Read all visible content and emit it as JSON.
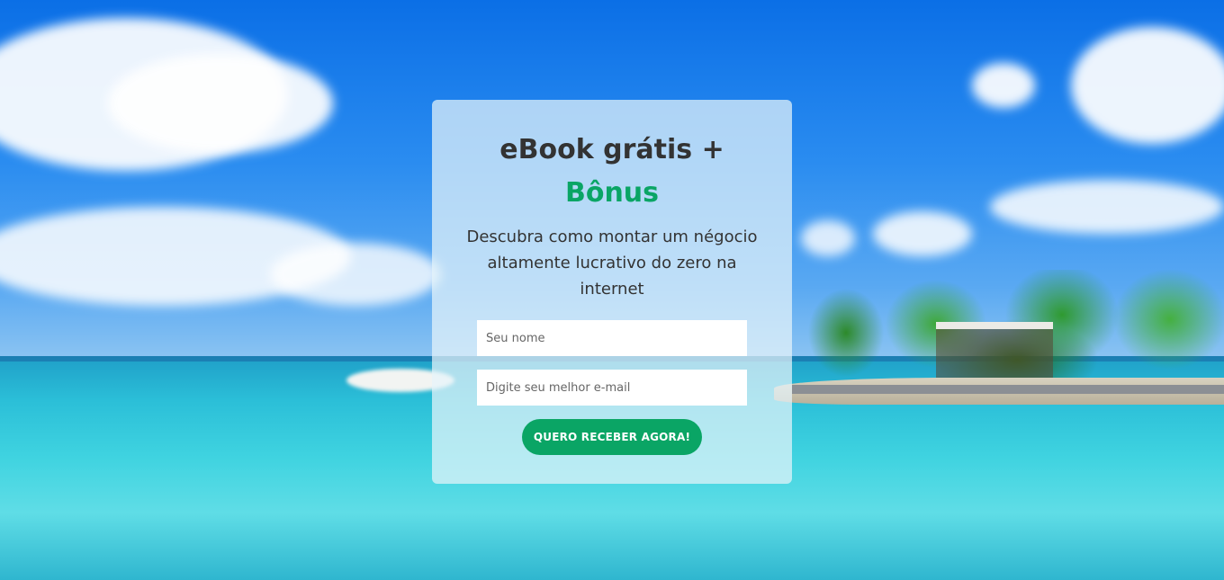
{
  "card": {
    "title": "eBook grátis +",
    "title_accent": "Bônus",
    "description": "Descubra como montar um négocio altamente lucrativo do zero na internet",
    "name_placeholder": "Seu nome",
    "email_placeholder": "Digite seu melhor e-mail",
    "cta_label": "QUERO RECEBER AGORA!"
  },
  "colors": {
    "accent": "#0aa565",
    "title_text": "#333333"
  }
}
